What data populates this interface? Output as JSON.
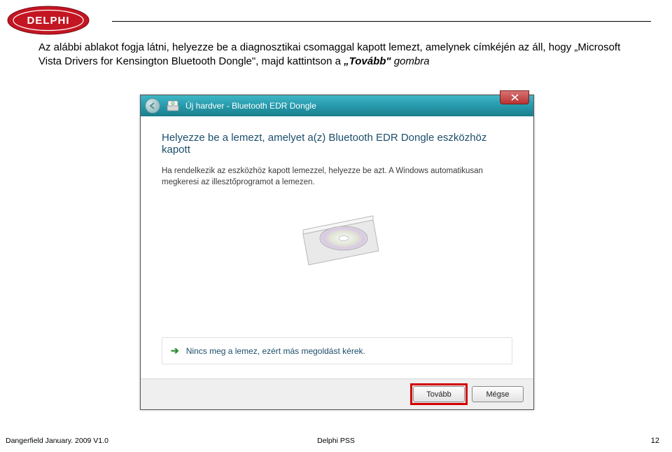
{
  "main_text": {
    "p1": "Az alábbi ablakot fogja látni, helyezze be a diagnosztikai csomaggal kapott lemezt, amelynek címkéjén az áll, hogy „Microsoft Vista Drivers for Kensington Bluetooth Dongle\", majd kattintson a ",
    "p2_bolditalic": "„Tovább\"",
    "p3_italic": " gombra"
  },
  "wizard": {
    "title": "Új hardver - Bluetooth EDR Dongle",
    "heading": "Helyezze be a lemezt, amelyet a(z) Bluetooth EDR Dongle eszközhöz kapott",
    "sub1": "Ha rendelkezik az eszközhöz kapott lemezzel, helyezze be azt. A Windows automatikusan megkeresi az illesztőprogramot a lemezen.",
    "link": "Nincs meg a lemez, ezért más megoldást kérek.",
    "btn_next": "Tovább",
    "btn_cancel": "Mégse"
  },
  "footer": {
    "left": "Dangerfield January. 2009 V1.0",
    "center": "Delphi PSS",
    "page": "12"
  }
}
